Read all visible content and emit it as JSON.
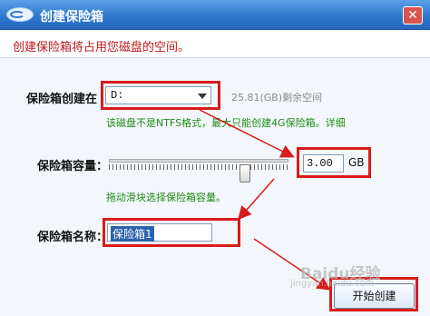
{
  "window": {
    "title": "创建保险箱",
    "close_glyph": "✕"
  },
  "header": {
    "text": "创建保险箱将占用您磁盘的空间。"
  },
  "form": {
    "drive_label": "保险箱创建在",
    "drive_value": "D:",
    "free_space": "25.81(GB)剩余空间",
    "drive_hint": "该磁盘不是NTFS格式，最大只能创建4G保险箱。详细",
    "capacity_label": "保险箱容量：",
    "capacity_value": "3.00",
    "capacity_unit": "GB",
    "slider_hint": "拖动滑块选择保险箱容量。",
    "name_label": "保险箱名称：",
    "name_value": "保险箱1"
  },
  "buttons": {
    "create": "开始创建"
  },
  "watermark": {
    "text": "Baidu经验",
    "url": "jingyan.baidu.com"
  },
  "colors": {
    "annotation": "#d91b1b",
    "header_text": "#c21818",
    "hint_text": "#1e8a18"
  }
}
